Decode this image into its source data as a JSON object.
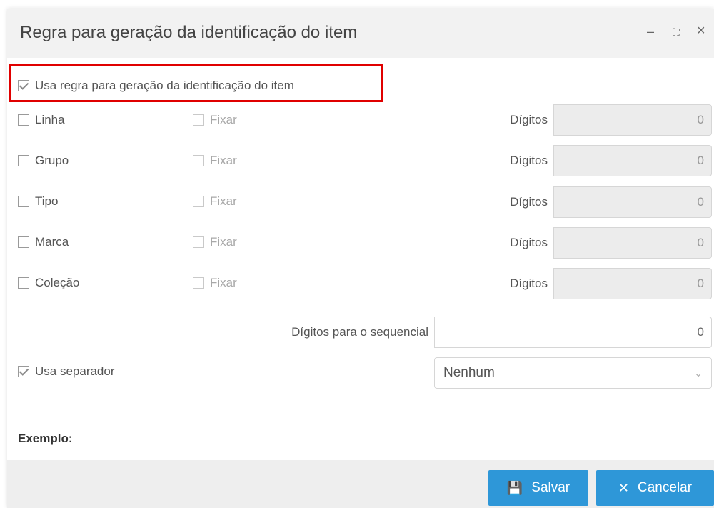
{
  "dialog": {
    "title": "Regra para geração da identificação do item",
    "controls": {
      "minimize": "–",
      "maximize": "⛶",
      "close": "×"
    }
  },
  "main_option": {
    "label": "Usa regra para geração da identificação do item",
    "checked": true
  },
  "rows": [
    {
      "label": "Linha",
      "fix_label": "Fixar",
      "digits_label": "Dígitos",
      "digits_value": "0"
    },
    {
      "label": "Grupo",
      "fix_label": "Fixar",
      "digits_label": "Dígitos",
      "digits_value": "0"
    },
    {
      "label": "Tipo",
      "fix_label": "Fixar",
      "digits_label": "Dígitos",
      "digits_value": "0"
    },
    {
      "label": "Marca",
      "fix_label": "Fixar",
      "digits_label": "Dígitos",
      "digits_value": "0"
    },
    {
      "label": "Coleção",
      "fix_label": "Fixar",
      "digits_label": "Dígitos",
      "digits_value": "0"
    }
  ],
  "sequence": {
    "label": "Dígitos para o sequencial",
    "value": "0"
  },
  "separator": {
    "label": "Usa separador",
    "checked": true,
    "select_value": "Nenhum"
  },
  "example": {
    "label": "Exemplo:"
  },
  "footer": {
    "save_label": "Salvar",
    "cancel_label": "Cancelar"
  },
  "colors": {
    "button": "#2e97d8",
    "highlight": "#e00000"
  }
}
